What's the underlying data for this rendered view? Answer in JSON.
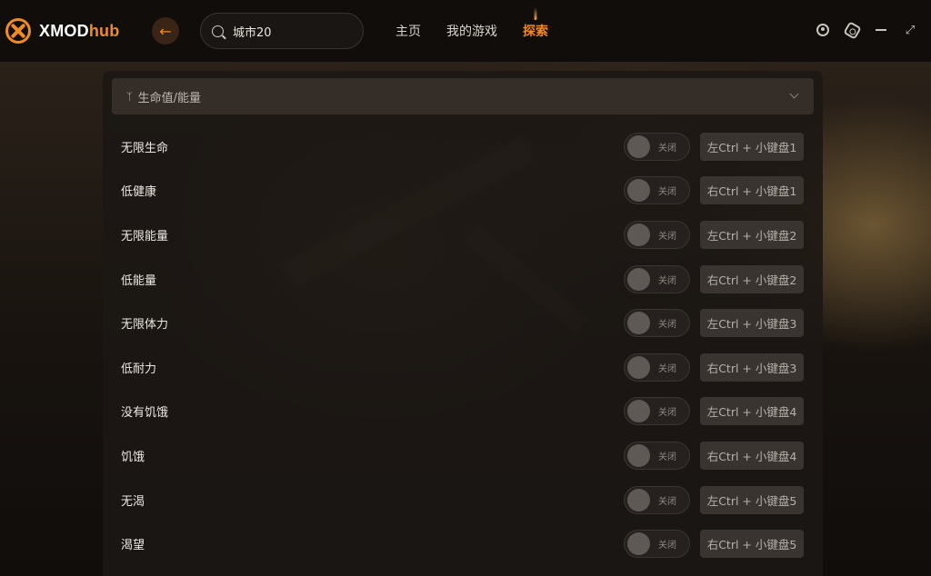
{
  "app": {
    "logo_text_main": "XMOD",
    "logo_text_accent": "hub",
    "accent_color": "#f08a24"
  },
  "search": {
    "value": "城市20",
    "icon": "search-icon"
  },
  "nav": {
    "items": [
      {
        "label": "主页",
        "active": false
      },
      {
        "label": "我的游戏",
        "active": false
      },
      {
        "label": "探索",
        "active": true
      }
    ]
  },
  "window_controls": [
    "user-icon",
    "settings-hex-icon",
    "minimize-icon",
    "maximize-icon"
  ],
  "section": {
    "icon": "bolt-icon",
    "title": "生命值/能量",
    "expanded": true
  },
  "cheats": [
    {
      "label": "无限生命",
      "toggle": "关闭",
      "hotkey": "左Ctrl + 小键盘1"
    },
    {
      "label": "低健康",
      "toggle": "关闭",
      "hotkey": "右Ctrl + 小键盘1"
    },
    {
      "label": "无限能量",
      "toggle": "关闭",
      "hotkey": "左Ctrl + 小键盘2"
    },
    {
      "label": "低能量",
      "toggle": "关闭",
      "hotkey": "右Ctrl + 小键盘2"
    },
    {
      "label": "无限体力",
      "toggle": "关闭",
      "hotkey": "左Ctrl + 小键盘3"
    },
    {
      "label": "低耐力",
      "toggle": "关闭",
      "hotkey": "右Ctrl + 小键盘3"
    },
    {
      "label": "没有饥饿",
      "toggle": "关闭",
      "hotkey": "左Ctrl + 小键盘4"
    },
    {
      "label": "饥饿",
      "toggle": "关闭",
      "hotkey": "右Ctrl + 小键盘4"
    },
    {
      "label": "无渴",
      "toggle": "关闭",
      "hotkey": "左Ctrl + 小键盘5"
    },
    {
      "label": "渴望",
      "toggle": "关闭",
      "hotkey": "右Ctrl + 小键盘5"
    }
  ]
}
